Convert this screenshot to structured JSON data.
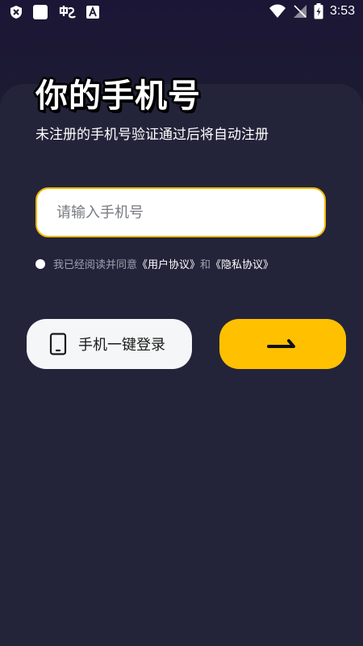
{
  "status_bar": {
    "time": "3:53",
    "left_icons": [
      "shield-x-icon",
      "square-icon",
      "app-logo-icon",
      "font-a-icon"
    ],
    "right_icons": [
      "wifi-icon",
      "signal-off-icon",
      "battery-charging-icon"
    ]
  },
  "login": {
    "title": "你的手机号",
    "subtitle": "未注册的手机号验证通过后将自动注册",
    "phone_placeholder": "请输入手机号",
    "phone_value": ""
  },
  "agreement": {
    "prefix": "我已经阅读并同意",
    "user_agreement": "《用户协议》",
    "conjunction": "和",
    "privacy_policy": "《隐私协议》",
    "checked": false
  },
  "buttons": {
    "one_key_login": "手机一键登录",
    "next_icon": "arrow-right-icon"
  },
  "colors": {
    "background": "#23243a",
    "accent": "#ffc000",
    "input_border": "#f5b800",
    "secondary_text": "#9ea1ad"
  }
}
